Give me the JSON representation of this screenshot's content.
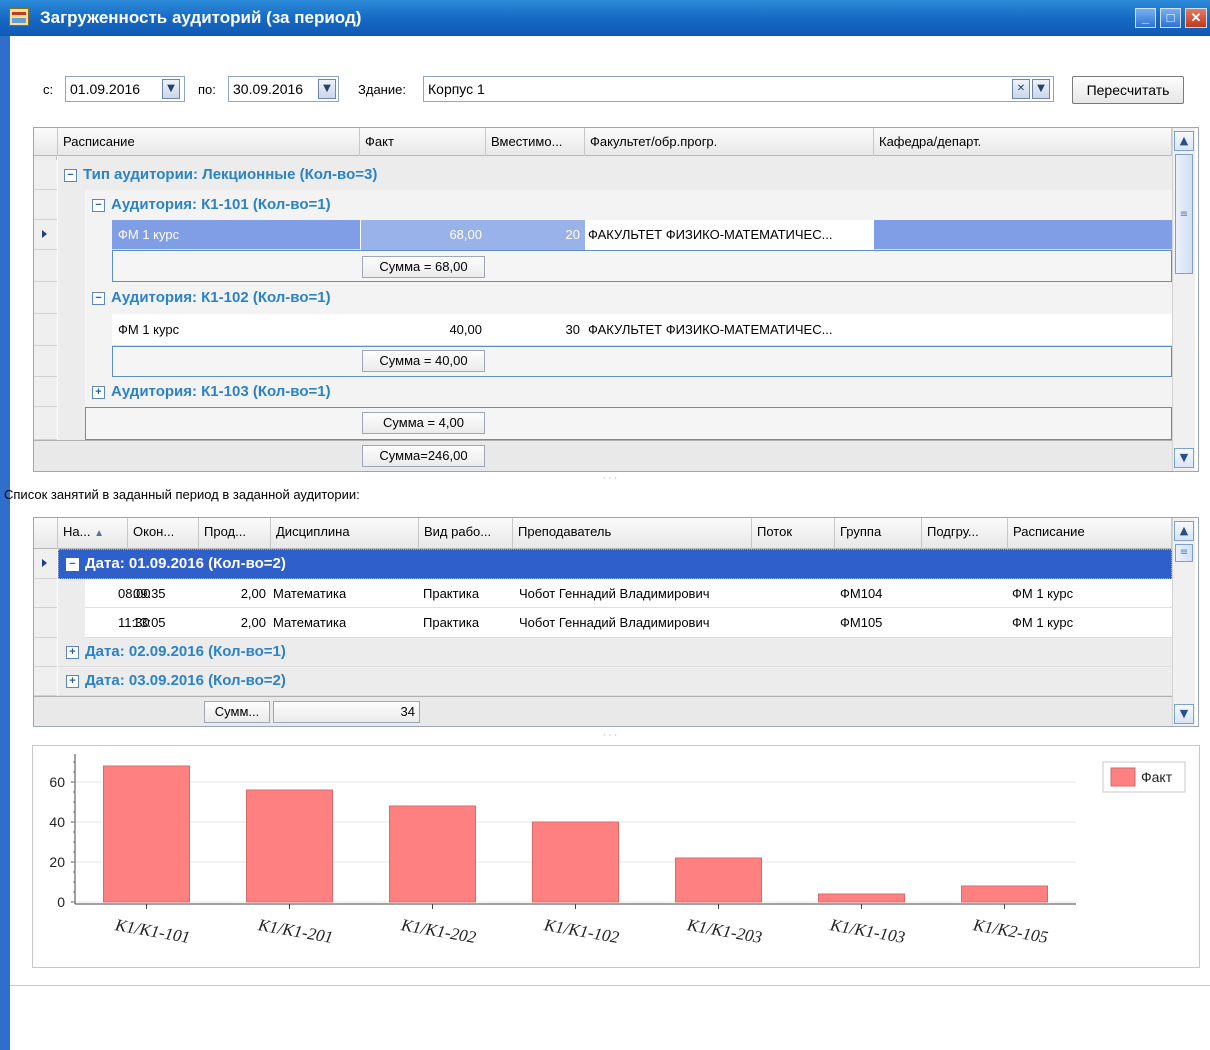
{
  "window": {
    "title": "Загруженность аудиторий (за период)"
  },
  "filter": {
    "from_label": "с:",
    "from_value": "01.09.2016",
    "to_label": "по:",
    "to_value": "30.09.2016",
    "building_label": "Здание:",
    "building_value": "Корпус 1",
    "recalc_label": "Пересчитать"
  },
  "grid1": {
    "columns": [
      "Расписание",
      "Факт",
      "Вместимо...",
      "Факультет/обр.прогр.",
      "Кафедра/департ."
    ],
    "type_group": "Тип аудитории: Лекционные (Кол-во=3)",
    "room1": {
      "group": "Аудитория: К1-101 (Кол-во=1)",
      "row": {
        "schedule": "ФМ 1 курс",
        "fact": "68,00",
        "capacity": "20",
        "faculty": "ФАКУЛЬТЕТ ФИЗИКО-МАТЕМАТИЧЕС..."
      },
      "sum": "Сумма = 68,00"
    },
    "room2": {
      "group": "Аудитория: К1-102 (Кол-во=1)",
      "row": {
        "schedule": "ФМ 1 курс",
        "fact": "40,00",
        "capacity": "30",
        "faculty": "ФАКУЛЬТЕТ ФИЗИКО-МАТЕМАТИЧЕС..."
      },
      "sum": "Сумма = 40,00"
    },
    "room3": {
      "group": "Аудитория: К1-103 (Кол-во=1)"
    },
    "type_sum": "Сумма = 4,00",
    "total_sum": "Сумма=246,00"
  },
  "section_label": "Список занятий в заданный период в заданной аудитории:",
  "grid2": {
    "columns": [
      "На...",
      "Окон...",
      "Прод...",
      "Дисциплина",
      "Вид рабо...",
      "Преподаватель",
      "Поток",
      "Группа",
      "Подгру...",
      "Расписание"
    ],
    "group1": "Дата: 01.09.2016 (Кол-во=2)",
    "rows": [
      {
        "start": "08:00",
        "end": "09:35",
        "dur": "2,00",
        "subject": "Математика",
        "kind": "Практика",
        "teacher": "Чобот Геннадий Владимирович",
        "stream": "",
        "group": "ФМ104",
        "subgroup": "",
        "schedule": "ФМ 1 курс"
      },
      {
        "start": "11:30",
        "end": "13:05",
        "dur": "2,00",
        "subject": "Математика",
        "kind": "Практика",
        "teacher": "Чобот Геннадий Владимирович",
        "stream": "",
        "group": "ФМ105",
        "subgroup": "",
        "schedule": "ФМ 1 курс"
      }
    ],
    "group2": "Дата: 02.09.2016 (Кол-во=1)",
    "group3": "Дата: 03.09.2016 (Кол-во=2)",
    "footer_label": "Сумм...",
    "footer_value": "34"
  },
  "chart_data": {
    "type": "bar",
    "categories": [
      "K1/K1-101",
      "K1/K1-201",
      "K1/K1-202",
      "K1/K1-102",
      "K1/K1-203",
      "K1/K1-103",
      "K1/K2-105"
    ],
    "series": [
      {
        "name": "Факт",
        "values": [
          68,
          56,
          48,
          40,
          22,
          4,
          8
        ]
      }
    ],
    "y_ticks": [
      "0",
      "20",
      "40",
      "60"
    ],
    "ylim": [
      0,
      72
    ],
    "grid": true,
    "legend": "top-right",
    "bar_color": "#ff8080"
  },
  "colors": {
    "title_bar": "#1467c1",
    "group_text": "#2b83c6",
    "selection": "#7f9ee6",
    "bar": "#ff8080"
  }
}
